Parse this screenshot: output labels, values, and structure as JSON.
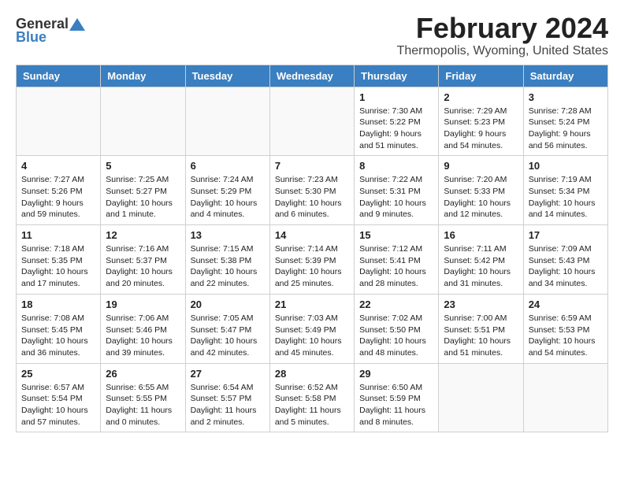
{
  "logo": {
    "general": "General",
    "blue": "Blue"
  },
  "header": {
    "month_title": "February 2024",
    "location": "Thermopolis, Wyoming, United States"
  },
  "days_of_week": [
    "Sunday",
    "Monday",
    "Tuesday",
    "Wednesday",
    "Thursday",
    "Friday",
    "Saturday"
  ],
  "weeks": [
    [
      {
        "day": "",
        "sunrise": "",
        "sunset": "",
        "daylight": ""
      },
      {
        "day": "",
        "sunrise": "",
        "sunset": "",
        "daylight": ""
      },
      {
        "day": "",
        "sunrise": "",
        "sunset": "",
        "daylight": ""
      },
      {
        "day": "",
        "sunrise": "",
        "sunset": "",
        "daylight": ""
      },
      {
        "day": "1",
        "sunrise": "Sunrise: 7:30 AM",
        "sunset": "Sunset: 5:22 PM",
        "daylight": "Daylight: 9 hours and 51 minutes."
      },
      {
        "day": "2",
        "sunrise": "Sunrise: 7:29 AM",
        "sunset": "Sunset: 5:23 PM",
        "daylight": "Daylight: 9 hours and 54 minutes."
      },
      {
        "day": "3",
        "sunrise": "Sunrise: 7:28 AM",
        "sunset": "Sunset: 5:24 PM",
        "daylight": "Daylight: 9 hours and 56 minutes."
      }
    ],
    [
      {
        "day": "4",
        "sunrise": "Sunrise: 7:27 AM",
        "sunset": "Sunset: 5:26 PM",
        "daylight": "Daylight: 9 hours and 59 minutes."
      },
      {
        "day": "5",
        "sunrise": "Sunrise: 7:25 AM",
        "sunset": "Sunset: 5:27 PM",
        "daylight": "Daylight: 10 hours and 1 minute."
      },
      {
        "day": "6",
        "sunrise": "Sunrise: 7:24 AM",
        "sunset": "Sunset: 5:29 PM",
        "daylight": "Daylight: 10 hours and 4 minutes."
      },
      {
        "day": "7",
        "sunrise": "Sunrise: 7:23 AM",
        "sunset": "Sunset: 5:30 PM",
        "daylight": "Daylight: 10 hours and 6 minutes."
      },
      {
        "day": "8",
        "sunrise": "Sunrise: 7:22 AM",
        "sunset": "Sunset: 5:31 PM",
        "daylight": "Daylight: 10 hours and 9 minutes."
      },
      {
        "day": "9",
        "sunrise": "Sunrise: 7:20 AM",
        "sunset": "Sunset: 5:33 PM",
        "daylight": "Daylight: 10 hours and 12 minutes."
      },
      {
        "day": "10",
        "sunrise": "Sunrise: 7:19 AM",
        "sunset": "Sunset: 5:34 PM",
        "daylight": "Daylight: 10 hours and 14 minutes."
      }
    ],
    [
      {
        "day": "11",
        "sunrise": "Sunrise: 7:18 AM",
        "sunset": "Sunset: 5:35 PM",
        "daylight": "Daylight: 10 hours and 17 minutes."
      },
      {
        "day": "12",
        "sunrise": "Sunrise: 7:16 AM",
        "sunset": "Sunset: 5:37 PM",
        "daylight": "Daylight: 10 hours and 20 minutes."
      },
      {
        "day": "13",
        "sunrise": "Sunrise: 7:15 AM",
        "sunset": "Sunset: 5:38 PM",
        "daylight": "Daylight: 10 hours and 22 minutes."
      },
      {
        "day": "14",
        "sunrise": "Sunrise: 7:14 AM",
        "sunset": "Sunset: 5:39 PM",
        "daylight": "Daylight: 10 hours and 25 minutes."
      },
      {
        "day": "15",
        "sunrise": "Sunrise: 7:12 AM",
        "sunset": "Sunset: 5:41 PM",
        "daylight": "Daylight: 10 hours and 28 minutes."
      },
      {
        "day": "16",
        "sunrise": "Sunrise: 7:11 AM",
        "sunset": "Sunset: 5:42 PM",
        "daylight": "Daylight: 10 hours and 31 minutes."
      },
      {
        "day": "17",
        "sunrise": "Sunrise: 7:09 AM",
        "sunset": "Sunset: 5:43 PM",
        "daylight": "Daylight: 10 hours and 34 minutes."
      }
    ],
    [
      {
        "day": "18",
        "sunrise": "Sunrise: 7:08 AM",
        "sunset": "Sunset: 5:45 PM",
        "daylight": "Daylight: 10 hours and 36 minutes."
      },
      {
        "day": "19",
        "sunrise": "Sunrise: 7:06 AM",
        "sunset": "Sunset: 5:46 PM",
        "daylight": "Daylight: 10 hours and 39 minutes."
      },
      {
        "day": "20",
        "sunrise": "Sunrise: 7:05 AM",
        "sunset": "Sunset: 5:47 PM",
        "daylight": "Daylight: 10 hours and 42 minutes."
      },
      {
        "day": "21",
        "sunrise": "Sunrise: 7:03 AM",
        "sunset": "Sunset: 5:49 PM",
        "daylight": "Daylight: 10 hours and 45 minutes."
      },
      {
        "day": "22",
        "sunrise": "Sunrise: 7:02 AM",
        "sunset": "Sunset: 5:50 PM",
        "daylight": "Daylight: 10 hours and 48 minutes."
      },
      {
        "day": "23",
        "sunrise": "Sunrise: 7:00 AM",
        "sunset": "Sunset: 5:51 PM",
        "daylight": "Daylight: 10 hours and 51 minutes."
      },
      {
        "day": "24",
        "sunrise": "Sunrise: 6:59 AM",
        "sunset": "Sunset: 5:53 PM",
        "daylight": "Daylight: 10 hours and 54 minutes."
      }
    ],
    [
      {
        "day": "25",
        "sunrise": "Sunrise: 6:57 AM",
        "sunset": "Sunset: 5:54 PM",
        "daylight": "Daylight: 10 hours and 57 minutes."
      },
      {
        "day": "26",
        "sunrise": "Sunrise: 6:55 AM",
        "sunset": "Sunset: 5:55 PM",
        "daylight": "Daylight: 11 hours and 0 minutes."
      },
      {
        "day": "27",
        "sunrise": "Sunrise: 6:54 AM",
        "sunset": "Sunset: 5:57 PM",
        "daylight": "Daylight: 11 hours and 2 minutes."
      },
      {
        "day": "28",
        "sunrise": "Sunrise: 6:52 AM",
        "sunset": "Sunset: 5:58 PM",
        "daylight": "Daylight: 11 hours and 5 minutes."
      },
      {
        "day": "29",
        "sunrise": "Sunrise: 6:50 AM",
        "sunset": "Sunset: 5:59 PM",
        "daylight": "Daylight: 11 hours and 8 minutes."
      },
      {
        "day": "",
        "sunrise": "",
        "sunset": "",
        "daylight": ""
      },
      {
        "day": "",
        "sunrise": "",
        "sunset": "",
        "daylight": ""
      }
    ]
  ]
}
